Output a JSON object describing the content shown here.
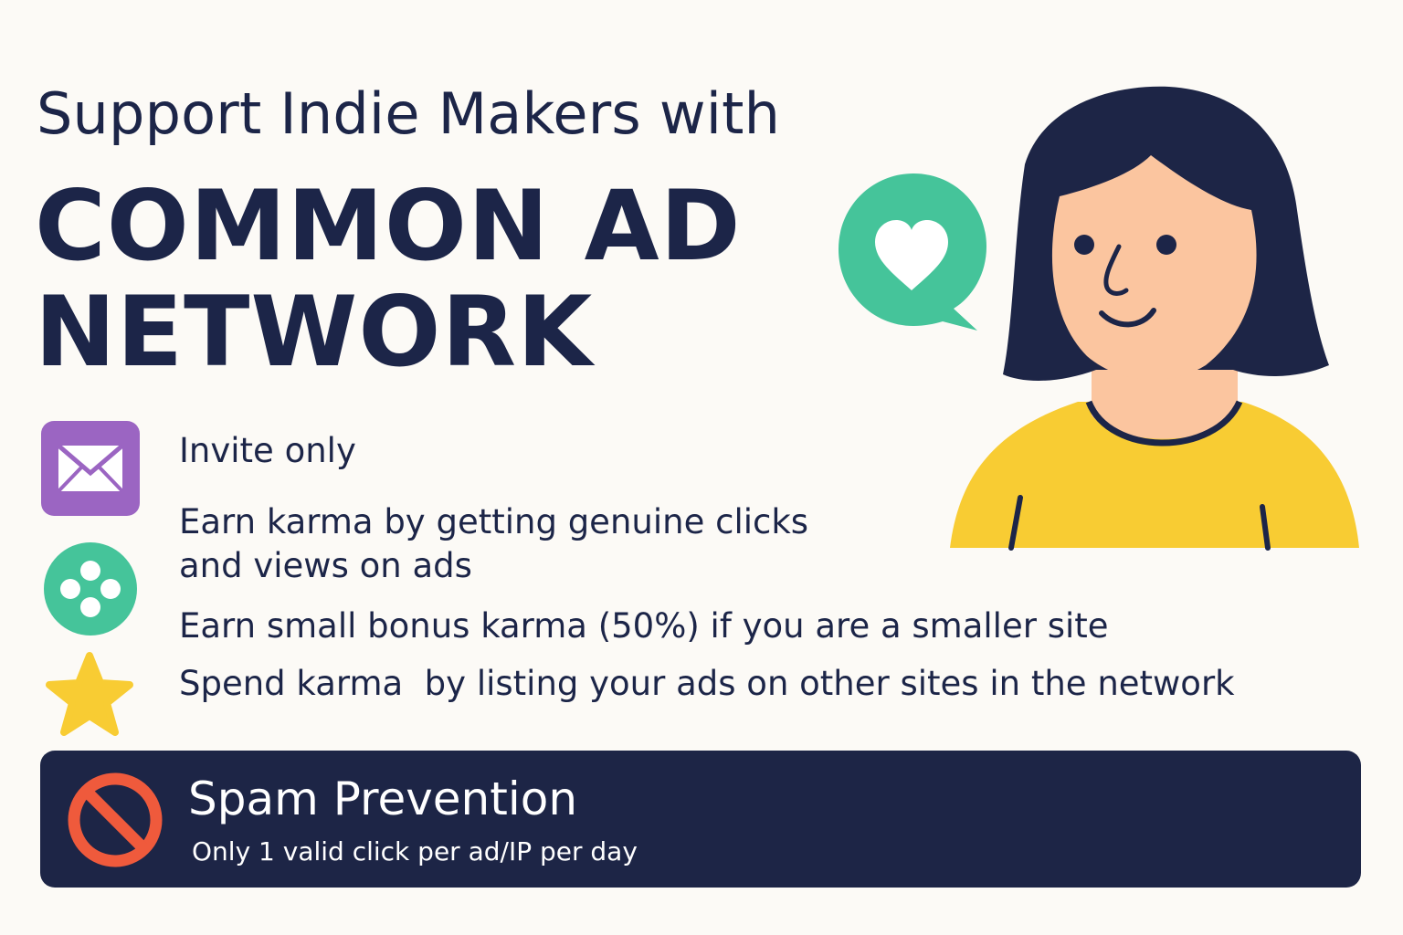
{
  "headline": {
    "line1": "Support Indie Makers with",
    "brand_line1": "COMMON AD",
    "brand_line2": "NETWORK"
  },
  "features": [
    {
      "text": "Invite only",
      "icon": "envelope-icon"
    },
    {
      "text": "Earn karma by getting genuine clicks\nand views on ads",
      "icon": "dots-circle-icon"
    },
    {
      "text": "Earn small bonus karma (50%) if you are a smaller site",
      "icon": ""
    },
    {
      "text": "Spend karma  by listing your ads on other sites in the network",
      "icon": "star-icon"
    }
  ],
  "spam": {
    "title": "Spam Prevention",
    "subtitle": "Only 1 valid click per ad/IP per day",
    "icon": "prohibited-icon"
  },
  "illustration": {
    "bubble_icon": "heart-speech-bubble-icon",
    "person": "smiling-woman-illustration"
  },
  "colors": {
    "background": "#fcfaf6",
    "navy": "#1c2548",
    "purple": "#9b65c2",
    "green": "#45c49a",
    "yellow": "#f8cc33",
    "red": "#ef5a3c",
    "skin": "#fbc59f"
  }
}
